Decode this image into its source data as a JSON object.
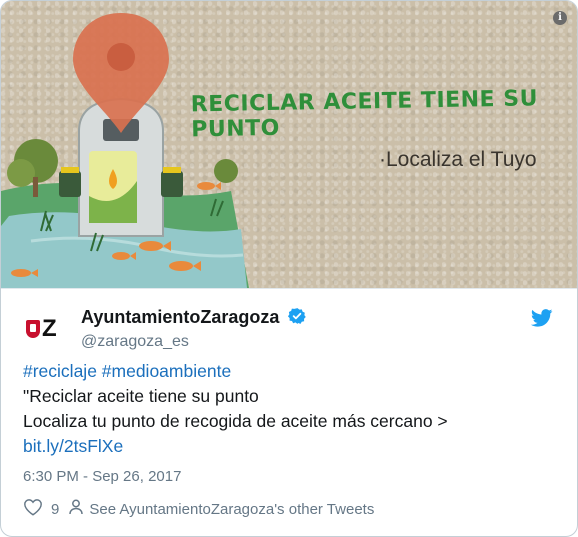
{
  "media": {
    "headline": "Reciclar aceite tiene su punto",
    "subheadline": "·Localiza el Tuyo",
    "info_icon": "info-icon"
  },
  "author": {
    "display_name": "AyuntamientoZaragoza",
    "handle": "@zaragoza_es",
    "avatar_letter": "Z",
    "verified_color": "#1da1f2"
  },
  "tweet": {
    "hashtags": "#reciclaje #medioambiente",
    "line1": "\"Reciclar aceite tiene su punto",
    "line2": "Localiza tu punto de recogida de aceite más cercano >",
    "link": "bit.ly/2tsFlXe",
    "timestamp": "6:30 PM - Sep 26, 2017"
  },
  "actions": {
    "likes": "9",
    "other_tweets": "See AyuntamientoZaragoza's other Tweets"
  },
  "colors": {
    "link": "#1b6fbc",
    "twitter_blue": "#1da1f2",
    "secondary_text": "#657786"
  }
}
